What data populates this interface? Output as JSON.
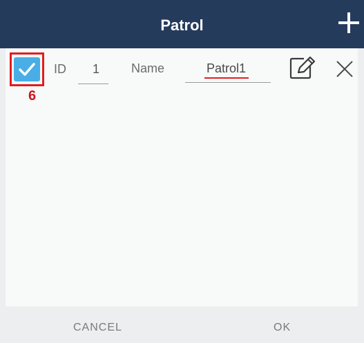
{
  "header": {
    "title": "Patrol"
  },
  "icons": {
    "add": "plus-icon",
    "edit": "pencil-square-icon",
    "delete": "close-x-icon",
    "check": "checkmark-icon"
  },
  "annotation": {
    "number": "6"
  },
  "row": {
    "checked": true,
    "id_label": "ID",
    "id_value": "1",
    "name_label": "Name",
    "name_value": "Patrol1"
  },
  "footer": {
    "cancel_label": "CANCEL",
    "ok_label": "OK"
  },
  "colors": {
    "header_bg": "#253b5c",
    "checkbox": "#49aee6",
    "highlight": "#e11d1d"
  }
}
